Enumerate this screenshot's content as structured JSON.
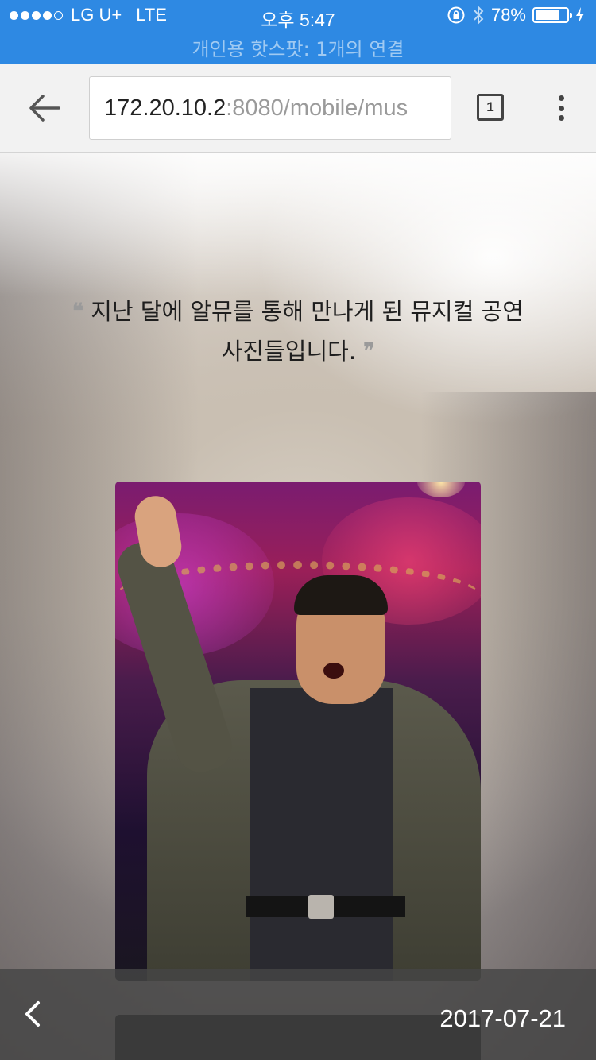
{
  "status_bar": {
    "carrier": "LG U+",
    "network": "LTE",
    "time": "오후 5:47",
    "battery": "78%",
    "battery_level": 0.78,
    "hotspot": "개인용 핫스팟: 1개의 연결",
    "color": "#2e89e3"
  },
  "browser": {
    "url_host": "172.20.10.2",
    "url_path": ":8080/mobile/mus",
    "tab_count": "1"
  },
  "content": {
    "quote_open": "❝",
    "quote_line1": "지난 달에 알뮤를 통해 만나게 된 뮤지컬 공연",
    "quote_line2": "사진들입니다.",
    "quote_close": "❞"
  },
  "footer": {
    "date": "2017-07-21"
  }
}
